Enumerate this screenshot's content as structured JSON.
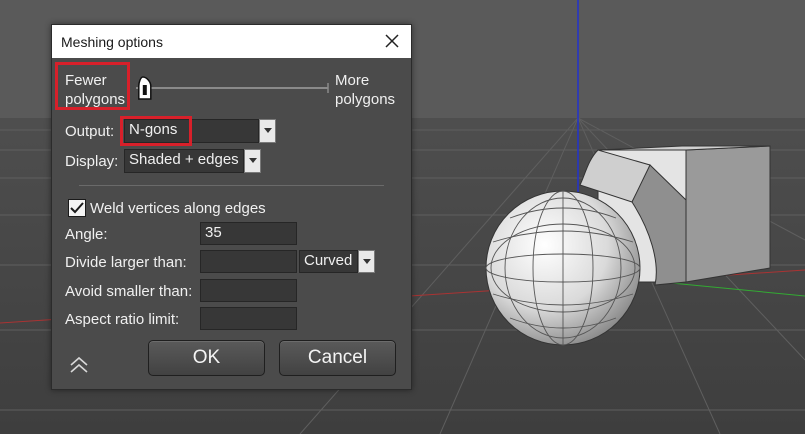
{
  "dialog": {
    "title": "Meshing options",
    "close_icon": "close-icon",
    "slider": {
      "left_label": "Fewer polygons",
      "right_label": "More polygons",
      "value": 0.06
    },
    "output": {
      "label": "Output:",
      "value": "N-gons"
    },
    "display": {
      "label": "Display:",
      "value": "Shaded + edges"
    },
    "weld": {
      "label": "Weld vertices along edges",
      "checked": true
    },
    "angle": {
      "label": "Angle:",
      "value": "35"
    },
    "divide": {
      "label": "Divide larger than:",
      "value": "",
      "mode": "Curved"
    },
    "avoid": {
      "label": "Avoid smaller than:",
      "value": ""
    },
    "aspect": {
      "label": "Aspect ratio limit:",
      "value": ""
    },
    "ok_label": "OK",
    "cancel_label": "Cancel",
    "collapse_icon": "double-chevron-up-icon"
  },
  "colors": {
    "highlight": "#d8202a",
    "dialog_bg": "#4b4b4b",
    "field_bg": "#373737",
    "viewport_bg": "#5a5a5a"
  }
}
